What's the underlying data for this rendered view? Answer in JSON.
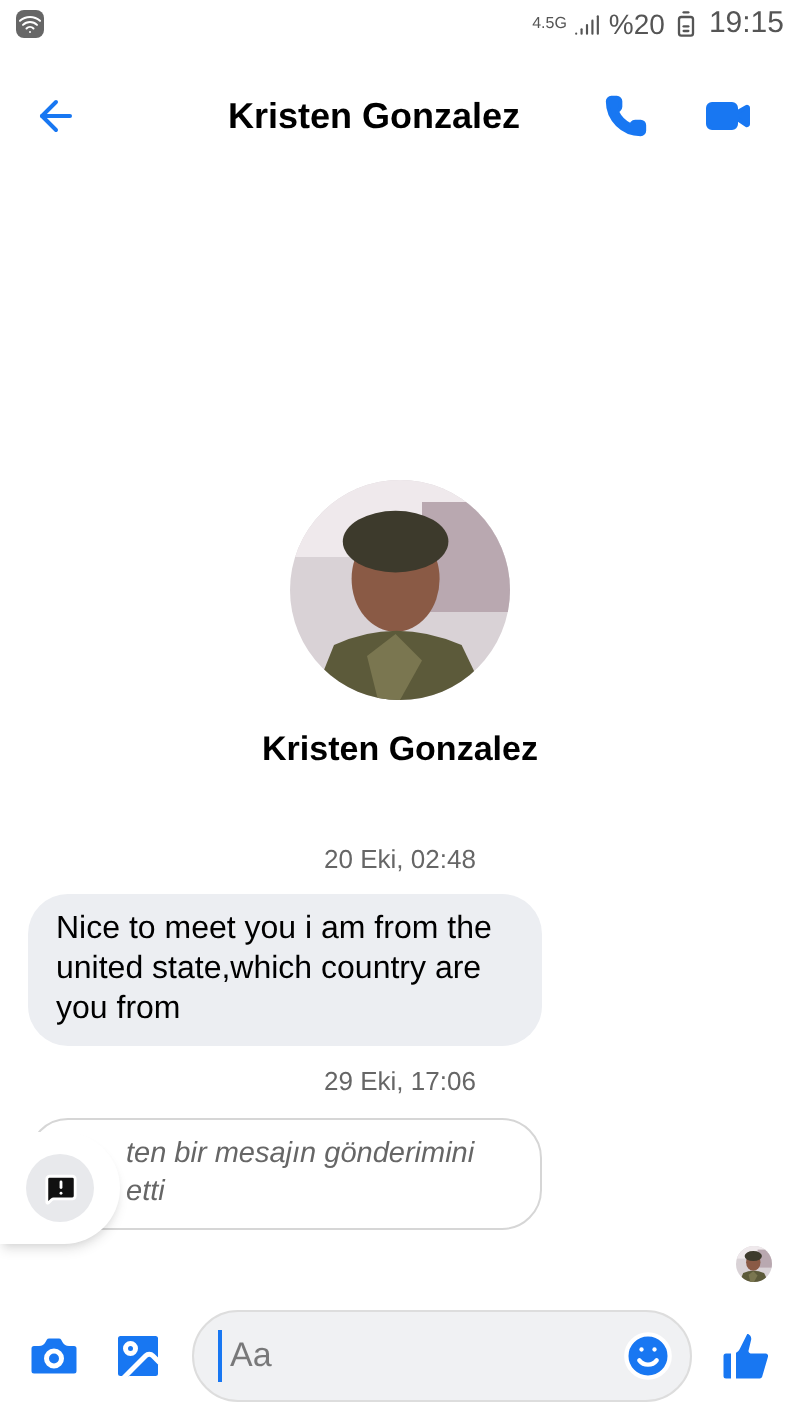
{
  "status_bar": {
    "network": "4.5G",
    "battery": "%20",
    "time": "19:15"
  },
  "header": {
    "title": "Kristen Gonzalez"
  },
  "profile": {
    "name": "Kristen Gonzalez"
  },
  "messages": [
    {
      "kind": "timestamp",
      "text": "20 Eki, 02:48"
    },
    {
      "kind": "received",
      "text": "Nice to meet you i am from the united state,which country are you from"
    },
    {
      "kind": "timestamp",
      "text": "29 Eki, 17:06"
    },
    {
      "kind": "unsent",
      "lines": [
        "ten bir mesajın gönderimini",
        "etti"
      ]
    }
  ],
  "composer": {
    "placeholder": "Aa"
  }
}
